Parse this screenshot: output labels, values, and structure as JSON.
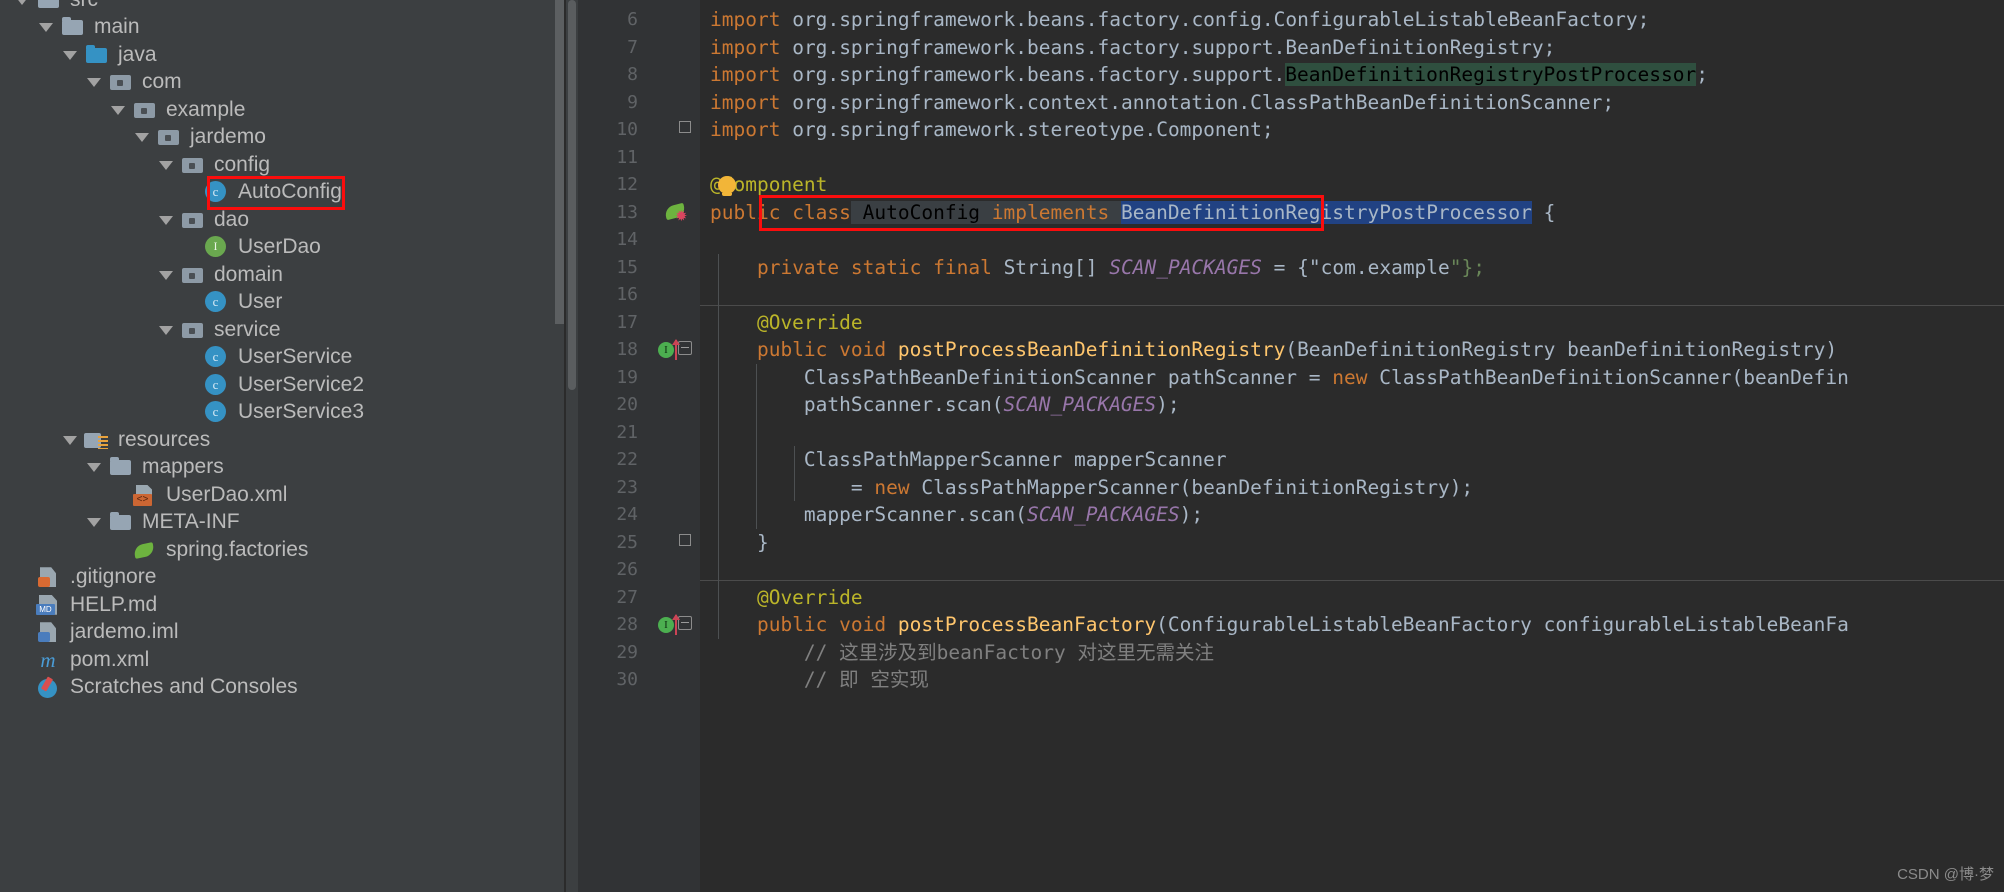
{
  "project_tree": {
    "rows": [
      {
        "label": "src",
        "indent": 0,
        "twisty": "open",
        "icon": "folder",
        "clipped": true
      },
      {
        "label": "main",
        "indent": 1,
        "twisty": "open",
        "icon": "folder"
      },
      {
        "label": "java",
        "indent": 2,
        "twisty": "open",
        "icon": "folder-src"
      },
      {
        "label": "com",
        "indent": 3,
        "twisty": "open",
        "icon": "pkg"
      },
      {
        "label": "example",
        "indent": 4,
        "twisty": "open",
        "icon": "pkg"
      },
      {
        "label": "jardemo",
        "indent": 5,
        "twisty": "open",
        "icon": "pkg"
      },
      {
        "label": "config",
        "indent": 6,
        "twisty": "open",
        "icon": "pkg"
      },
      {
        "label": "AutoConfig",
        "indent": 7,
        "twisty": "none",
        "icon": "cls"
      },
      {
        "label": "dao",
        "indent": 6,
        "twisty": "open",
        "icon": "pkg"
      },
      {
        "label": "UserDao",
        "indent": 7,
        "twisty": "none",
        "icon": "iface"
      },
      {
        "label": "domain",
        "indent": 6,
        "twisty": "open",
        "icon": "pkg"
      },
      {
        "label": "User",
        "indent": 7,
        "twisty": "none",
        "icon": "cls"
      },
      {
        "label": "service",
        "indent": 6,
        "twisty": "open",
        "icon": "pkg"
      },
      {
        "label": "UserService",
        "indent": 7,
        "twisty": "none",
        "icon": "cls"
      },
      {
        "label": "UserService2",
        "indent": 7,
        "twisty": "none",
        "icon": "cls"
      },
      {
        "label": "UserService3",
        "indent": 7,
        "twisty": "none",
        "icon": "cls"
      },
      {
        "label": "resources",
        "indent": 2,
        "twisty": "open",
        "icon": "res"
      },
      {
        "label": "mappers",
        "indent": 3,
        "twisty": "open",
        "icon": "folder"
      },
      {
        "label": "UserDao.xml",
        "indent": 4,
        "twisty": "none",
        "icon": "xml"
      },
      {
        "label": "META-INF",
        "indent": 3,
        "twisty": "open",
        "icon": "folder"
      },
      {
        "label": "spring.factories",
        "indent": 4,
        "twisty": "none",
        "icon": "spring"
      },
      {
        "label": ".gitignore",
        "indent": 0,
        "twisty": "none",
        "icon": "git"
      },
      {
        "label": "HELP.md",
        "indent": 0,
        "twisty": "none",
        "icon": "md"
      },
      {
        "label": "jardemo.iml",
        "indent": 0,
        "twisty": "none",
        "icon": "iml"
      },
      {
        "label": "pom.xml",
        "indent": 0,
        "twisty": "none",
        "icon": "maven"
      },
      {
        "label": "Scratches and Consoles",
        "indent": 0,
        "twisty": "none",
        "icon": "scratch"
      }
    ],
    "selected_row_index": 7,
    "highlight_color": "#fb0d0d"
  },
  "editor": {
    "first_visible_line": 6,
    "last_visible_line": 30,
    "line_numbers": [
      6,
      7,
      8,
      9,
      10,
      11,
      12,
      13,
      14,
      15,
      16,
      17,
      18,
      19,
      20,
      21,
      22,
      23,
      24,
      25,
      26,
      27,
      28,
      29,
      30
    ],
    "highlight_color": "#fb0d0d",
    "lines": [
      {
        "n": 6,
        "text": "import org.springframework.beans.factory.config.ConfigurableListableBeanFactory;"
      },
      {
        "n": 7,
        "text": "import org.springframework.beans.factory.support.BeanDefinitionRegistry;"
      },
      {
        "n": 8,
        "text": "import org.springframework.beans.factory.support.BeanDefinitionRegistryPostProcessor;"
      },
      {
        "n": 9,
        "text": "import org.springframework.context.annotation.ClassPathBeanDefinitionScanner;"
      },
      {
        "n": 10,
        "text": "import org.springframework.stereotype.Component;"
      },
      {
        "n": 11,
        "text": ""
      },
      {
        "n": 12,
        "text": "@Component"
      },
      {
        "n": 13,
        "text": "public class AutoConfig implements BeanDefinitionRegistryPostProcessor {"
      },
      {
        "n": 14,
        "text": ""
      },
      {
        "n": 15,
        "text": "    private static final String[] SCAN_PACKAGES = {\"com.example\"};"
      },
      {
        "n": 16,
        "text": ""
      },
      {
        "n": 17,
        "text": "    @Override"
      },
      {
        "n": 18,
        "text": "    public void postProcessBeanDefinitionRegistry(BeanDefinitionRegistry beanDefinitionRegistry)"
      },
      {
        "n": 19,
        "text": "        ClassPathBeanDefinitionScanner pathScanner = new ClassPathBeanDefinitionScanner(beanDefin"
      },
      {
        "n": 20,
        "text": "        pathScanner.scan(SCAN_PACKAGES);"
      },
      {
        "n": 21,
        "text": ""
      },
      {
        "n": 22,
        "text": "        ClassPathMapperScanner mapperScanner"
      },
      {
        "n": 23,
        "text": "            = new ClassPathMapperScanner(beanDefinitionRegistry);"
      },
      {
        "n": 24,
        "text": "        mapperScanner.scan(SCAN_PACKAGES);"
      },
      {
        "n": 25,
        "text": "    }"
      },
      {
        "n": 26,
        "text": ""
      },
      {
        "n": 27,
        "text": "    @Override"
      },
      {
        "n": 28,
        "text": "    public void postProcessBeanFactory(ConfigurableListableBeanFactory configurableListableBeanFa"
      },
      {
        "n": 29,
        "text": "        // 这里涉及到beanFactory 对这里无需关注"
      },
      {
        "n": 30,
        "text": "        // 即 空实现"
      }
    ],
    "gutter_icons": [
      {
        "line": 12,
        "icon": "lightbulb-icon"
      },
      {
        "line": 13,
        "icon": "spring-bean-icon"
      },
      {
        "line": 18,
        "icon": "implementing-method-icon"
      },
      {
        "line": 28,
        "icon": "implementing-method-icon"
      }
    ],
    "selected_text": "AutoConfig implements BeanDefinitionRegistryPostProcessor",
    "search_match_text": "BeanDefinitionRegistryPostProcessor"
  },
  "watermark": {
    "text": "CSDN @博·梦"
  }
}
